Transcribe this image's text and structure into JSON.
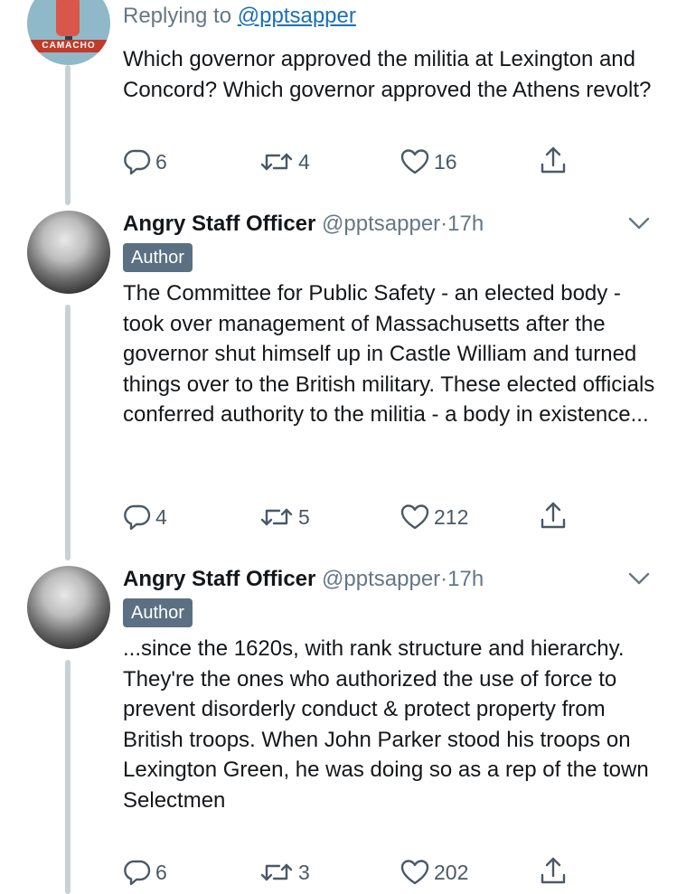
{
  "parent": {
    "replying_prefix": "Replying to",
    "replying_handle": "@pptsapper",
    "text": "Which governor approved the militia at Lexington and Concord? Which governor approved the Athens revolt?",
    "avatar_label": "CAMACHO",
    "replies": "6",
    "retweets": "4",
    "likes": "16"
  },
  "tweets": [
    {
      "name": "Angry Staff Officer",
      "handle": "@pptsapper",
      "sep": "·",
      "time": "17h",
      "badge": "Author",
      "text": "The Committee for Public Safety - an elected body - took over management of Massachusetts after the governor shut himself up in Castle William and turned things over to the British military. These elected officials conferred authority to the militia - a body in existence...",
      "replies": "4",
      "retweets": "5",
      "likes": "212"
    },
    {
      "name": "Angry Staff Officer",
      "handle": "@pptsapper",
      "sep": "·",
      "time": "17h",
      "badge": "Author",
      "text": "...since the 1620s, with rank structure and hierarchy. They're the ones who authorized the use of force to prevent disorderly conduct & protect property from British troops. When John Parker stood his troops on Lexington Green, he was doing so as a rep of the town Selectmen",
      "replies": "6",
      "retweets": "3",
      "likes": "202"
    }
  ],
  "icons": {
    "reply": "reply-icon",
    "retweet": "retweet-icon",
    "like": "heart-icon",
    "share": "share-icon",
    "menu": "chevron-down-icon"
  },
  "colors": {
    "link": "#1b6fb8",
    "muted": "#657786",
    "badge": "#5b7083",
    "thread_line": "#c9d1d8"
  }
}
